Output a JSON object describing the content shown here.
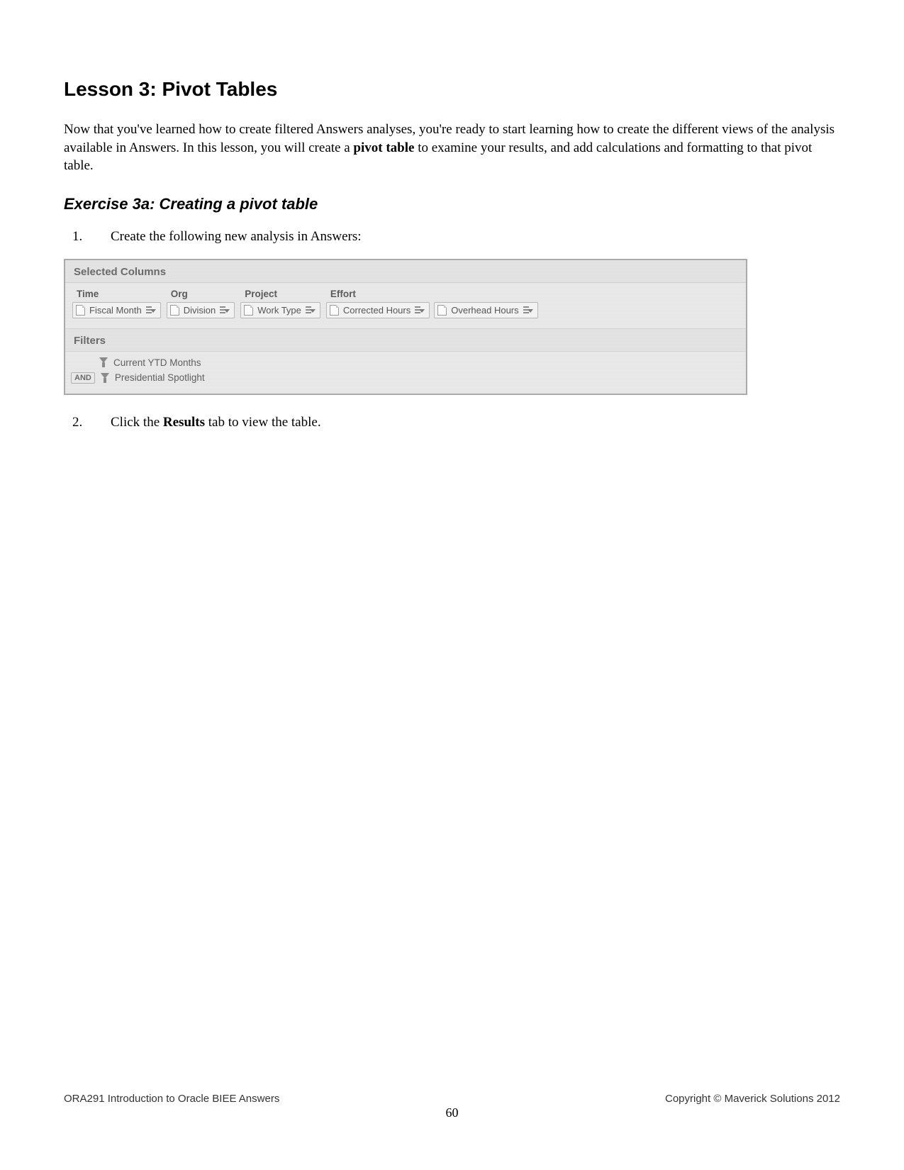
{
  "lesson_title": "Lesson 3: Pivot Tables",
  "intro_parts": {
    "a": "Now that you've learned how to create filtered Answers analyses, you're ready to start learning how to create the different views of the analysis available in Answers.  In this lesson, you will create a ",
    "bold1": "pivot table",
    "b": " to examine your results, and add calculations and formatting to that pivot table."
  },
  "exercise_title": "Exercise 3a: Creating a pivot table",
  "steps": {
    "s1": "Create the following new analysis in Answers:",
    "s2_a": "Click the ",
    "s2_bold": "Results",
    "s2_b": " tab to view the table."
  },
  "criteria": {
    "selected_header": "Selected Columns",
    "filters_header": "Filters",
    "groups": [
      {
        "name": "Time",
        "columns": [
          "Fiscal Month"
        ]
      },
      {
        "name": "Org",
        "columns": [
          "Division"
        ]
      },
      {
        "name": "Project",
        "columns": [
          "Work Type"
        ]
      },
      {
        "name": "Effort",
        "columns": [
          "Corrected Hours",
          "Overhead Hours"
        ]
      }
    ],
    "filters": {
      "row1": "Current YTD Months",
      "operator": "AND",
      "row2": "Presidential Spotlight"
    }
  },
  "footer": {
    "left": "ORA291 Introduction to Oracle BIEE Answers",
    "right": "Copyright © Maverick Solutions 2012",
    "page": "60"
  }
}
